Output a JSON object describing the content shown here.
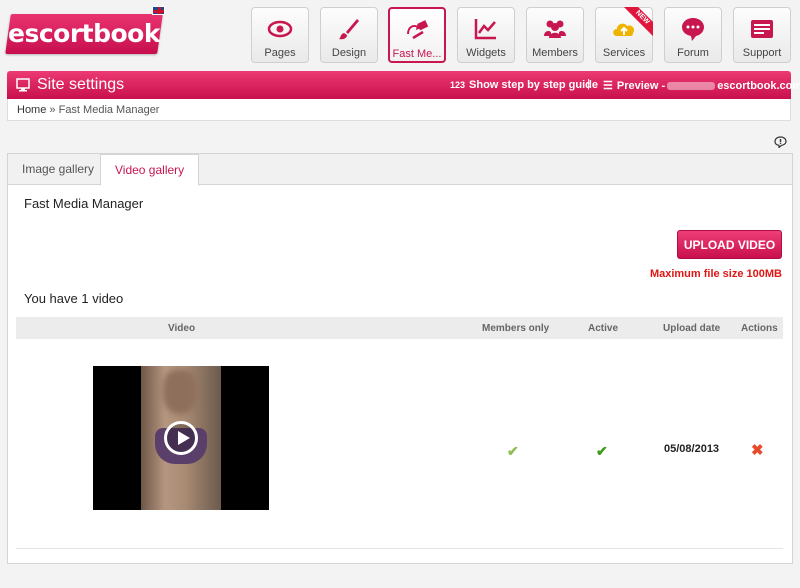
{
  "brand": {
    "logo_text": "escortbook"
  },
  "nav": [
    {
      "label": "Pages",
      "icon": "eye-icon"
    },
    {
      "label": "Design",
      "icon": "brush-icon"
    },
    {
      "label": "Fast Me...",
      "icon": "fast-media-icon",
      "active": true
    },
    {
      "label": "Widgets",
      "icon": "chart-icon"
    },
    {
      "label": "Members",
      "icon": "members-icon"
    },
    {
      "label": "Services",
      "icon": "cloud-upload-icon",
      "badge": "NEW"
    },
    {
      "label": "Forum",
      "icon": "chat-icon"
    },
    {
      "label": "Support",
      "icon": "support-icon"
    }
  ],
  "titlebar": {
    "title": "Site settings",
    "guide_label": "Show step by step guide",
    "guide_prefix": "123",
    "separator": "|",
    "preview_label": "Preview -",
    "preview_domain": "escortbook.com"
  },
  "breadcrumb": {
    "home": "Home",
    "sep": "»",
    "current": "Fast Media Manager"
  },
  "tabs": [
    "Image gallery",
    "Video gallery"
  ],
  "main": {
    "heading": "Fast Media Manager",
    "upload_label": "UPLOAD VIDEO",
    "max_size": "Maximum file size 100MB",
    "count_text": "You have 1 video"
  },
  "table": {
    "columns": [
      "Video",
      "Members only",
      "Active",
      "Upload date",
      "Actions"
    ],
    "rows": [
      {
        "members_only": "✔",
        "active": "✔",
        "upload_date": "05/08/2013",
        "action": "✖"
      }
    ]
  },
  "colors": {
    "brand": "#d41a5a",
    "check_light": "#8cc152",
    "check_dark": "#3d9a14",
    "delete": "#e8492a",
    "warning": "#e01616"
  }
}
